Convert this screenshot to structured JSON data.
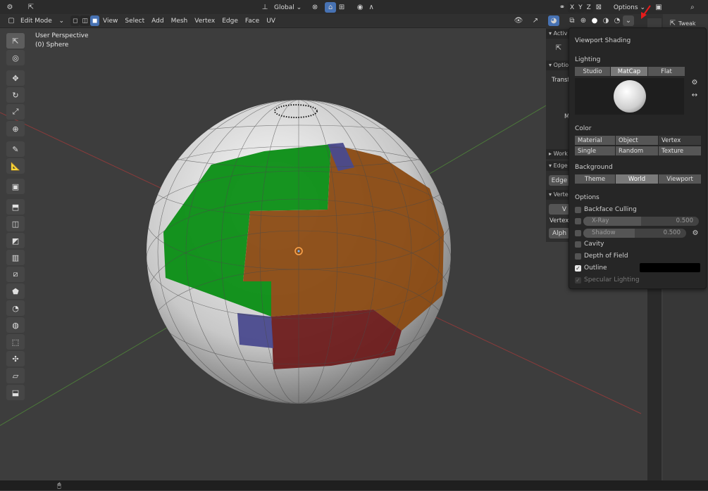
{
  "top_bar": {
    "transform_orientation": "Global",
    "axes": [
      "X",
      "Y",
      "Z"
    ],
    "options_label": "Options"
  },
  "header": {
    "mode": "Edit Mode",
    "menus": [
      "View",
      "Select",
      "Add",
      "Mesh",
      "Vertex",
      "Edge",
      "Face",
      "UV"
    ]
  },
  "viewport": {
    "perspective": "User Perspective",
    "object": "(0) Sphere"
  },
  "n_panel": {
    "active_tool_header": "Activ",
    "options_header": "Optio",
    "transform_label": "Transf",
    "m_label": "M",
    "workspace_header": "Work",
    "edge_header": "Edge",
    "edge_value": "Edge",
    "vertex_header": "Verte",
    "vertex_btn": "V",
    "vertex_label": "Vertex",
    "alpha_label": "Alph"
  },
  "viewport_shading": {
    "title": "Viewport Shading",
    "lighting_label": "Lighting",
    "lighting_options": [
      "Studio",
      "MatCap",
      "Flat"
    ],
    "lighting_selected": "MatCap",
    "color_label": "Color",
    "color_options_row1": [
      "Material",
      "Object",
      "Vertex"
    ],
    "color_options_row2": [
      "Single",
      "Random",
      "Texture"
    ],
    "background_label": "Background",
    "background_options": [
      "Theme",
      "World",
      "Viewport"
    ],
    "background_selected": "World",
    "options_label": "Options",
    "backface_culling": "Backface Culling",
    "xray_label": "X-Ray",
    "xray_value": "0.500",
    "shadow_label": "Shadow",
    "shadow_value": "0.500",
    "cavity": "Cavity",
    "depth_of_field": "Depth of Field",
    "outline": "Outline",
    "outline_color": "#000000",
    "specular_lighting": "Specular Lighting"
  },
  "properties": {
    "tweak_label": "Tweak"
  },
  "colors": {
    "green": "#0a8e14",
    "orange": "#8a4a12",
    "red": "#6e1c1c",
    "blue": "#4a4a8e",
    "white_face": "#c9c9c9",
    "accent_arrow": "#e51b1b"
  }
}
